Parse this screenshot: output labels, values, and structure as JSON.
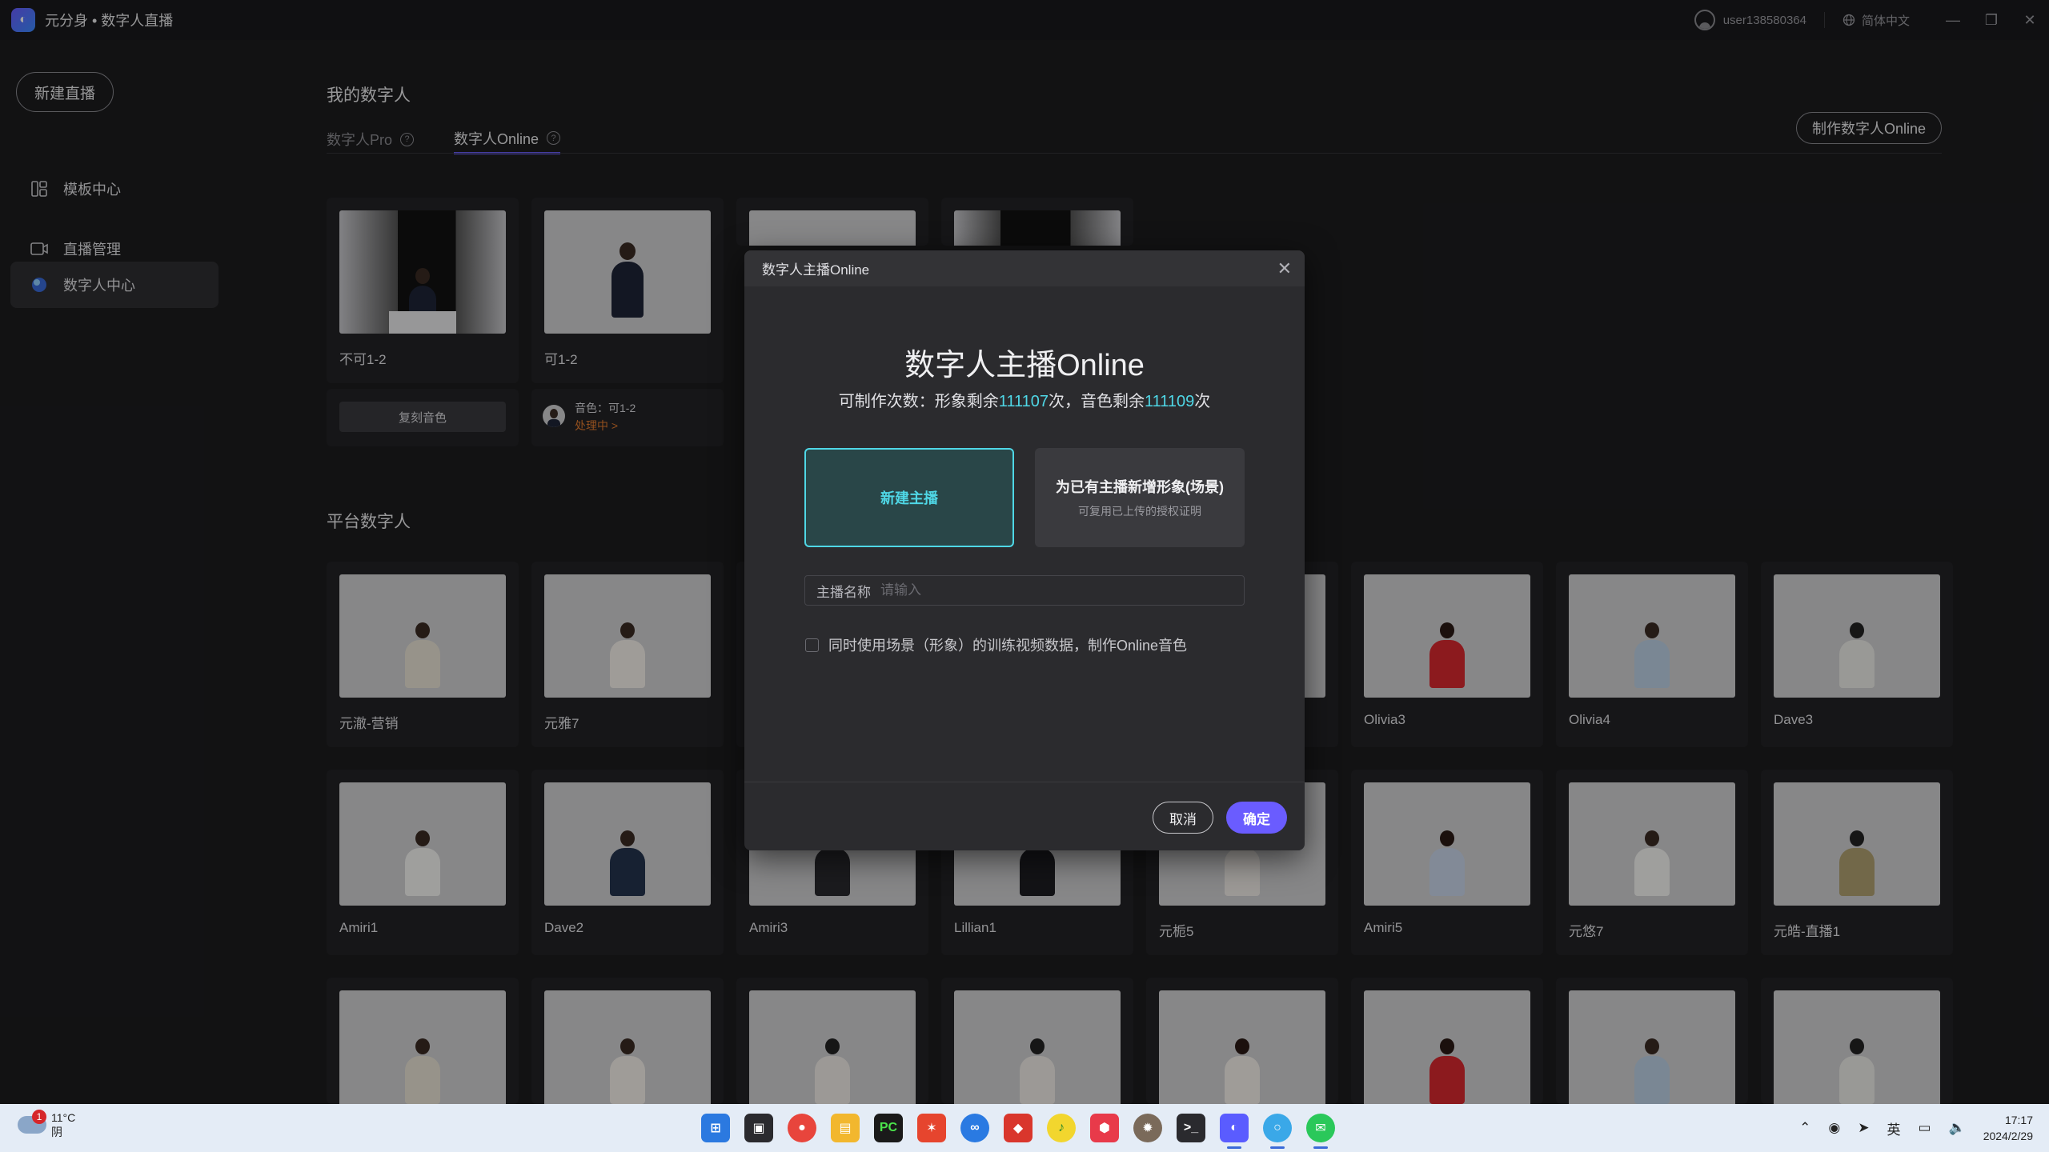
{
  "app": {
    "title": "元分身 • 数字人直播",
    "user": "user138580364",
    "language": "简体中文"
  },
  "sidebar": {
    "new_live": "新建直播",
    "items": [
      {
        "label": "模板中心",
        "icon": "template-icon"
      },
      {
        "label": "直播管理",
        "icon": "video-icon"
      },
      {
        "label": "数字人中心",
        "icon": "avatar-globe-icon"
      }
    ]
  },
  "main": {
    "my_title": "我的数字人",
    "tabs": [
      {
        "label": "数字人Pro"
      },
      {
        "label": "数字人Online"
      }
    ],
    "make_button": "制作数字人Online",
    "my_cards": [
      {
        "name": "不可1-2",
        "action": "复刻音色"
      },
      {
        "name": "可1-2",
        "voice_label": "音色：可1-2",
        "voice_status": "处理中 >"
      }
    ],
    "platform_title": "平台数字人",
    "platform_row1": [
      "元澈-营销",
      "元雅7",
      "",
      "",
      "",
      "Olivia3",
      "Olivia4",
      "Dave3"
    ],
    "platform_row2": [
      "Amiri1",
      "Dave2",
      "Amiri3",
      "Lillian1",
      "元栀5",
      "Amiri5",
      "元悠7",
      "元皓-直播1"
    ]
  },
  "dialog": {
    "header": "数字人主播Online",
    "title": "数字人主播Online",
    "quota_prefix": "可制作次数：形象剩余",
    "image_left": "111107",
    "quota_mid": "次，音色剩余",
    "voice_left": "111109",
    "quota_suffix": "次",
    "option_new": "新建主播",
    "option_add": "为已有主播新增形象(场景)",
    "option_add_sub": "可复用已上传的授权证明",
    "name_label": "主播名称",
    "name_placeholder": "请输入",
    "checkbox_label": "同时使用场景（形象）的训练视频数据，制作Online音色",
    "cancel": "取消",
    "confirm": "确定"
  },
  "taskbar": {
    "temp": "11°C",
    "weather": "阴",
    "badge": "1",
    "time": "17:17",
    "date": "2024/2/29",
    "ime": "英"
  }
}
